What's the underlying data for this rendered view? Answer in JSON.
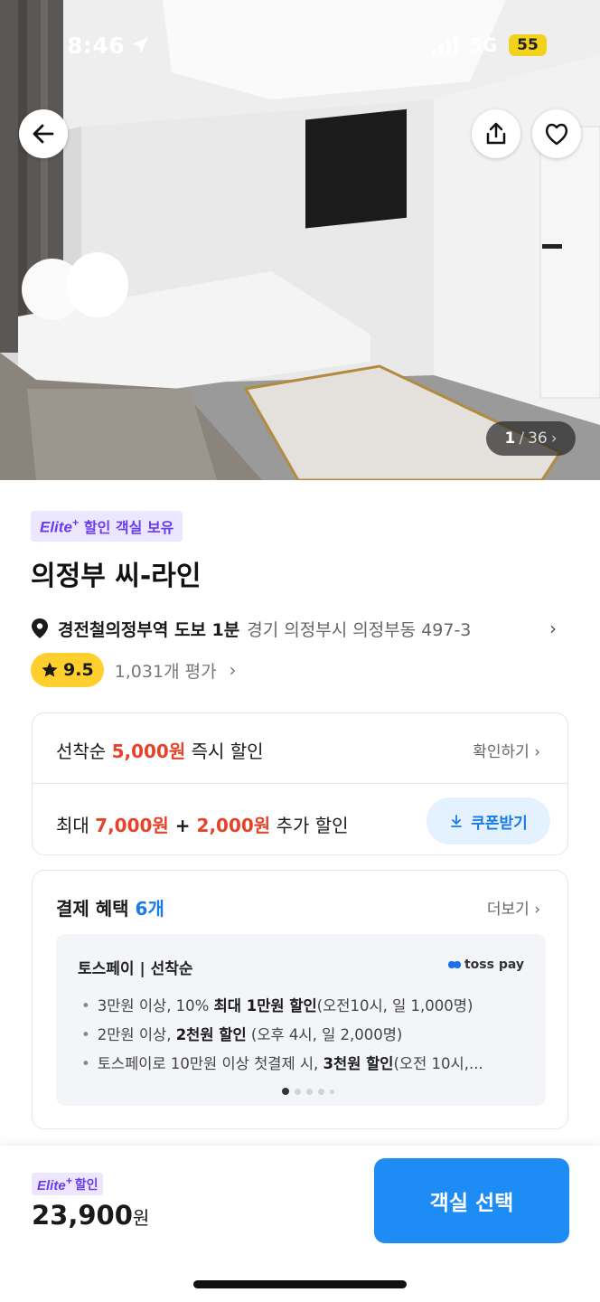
{
  "status_bar": {
    "time": "8:46",
    "network": "5G",
    "battery": "55"
  },
  "gallery": {
    "current": "1",
    "separator": "/",
    "total": "36"
  },
  "icons": {
    "back": "arrow-left-icon",
    "share": "share-icon",
    "favorite": "heart-icon",
    "location": "location-pin-icon",
    "star": "star-icon",
    "download": "download-icon"
  },
  "elite_badge": {
    "logo": "Elite",
    "plus": "+",
    "text": "할인 객실 보유"
  },
  "hotel": {
    "name": "의정부 씨-라인",
    "address_highlight": "경전철의정부역 도보 1분",
    "address": "경기 의정부시 의정부동 497-3",
    "rating": "9.5",
    "review_count": "1,031개 평가"
  },
  "discounts": {
    "row1": {
      "prefix": "선착순 ",
      "amount": "5,000원",
      "suffix": " 즉시 할인",
      "link": "확인하기 ›"
    },
    "row2": {
      "prefix": "최대 ",
      "amount1": "7,000원",
      "plus": " + ",
      "amount2": "2,000원",
      "suffix": " 추가 할인",
      "button": "쿠폰받기"
    }
  },
  "payment": {
    "title": "결제 혜택 ",
    "count": "6개",
    "more": "더보기 ›",
    "card_title": "토스페이 | 선착순",
    "brand": "toss pay",
    "benefits": [
      {
        "pre": "3만원 이상, 10% ",
        "bold": "최대 1만원 할인",
        "post": "(오전10시, 일 1,000명)"
      },
      {
        "pre": "2만원 이상, ",
        "bold": "2천원 할인",
        "post": " (오후 4시, 일 2,000명)"
      },
      {
        "pre": "토스페이로 10만원 이상 첫결제 시, ",
        "bold": "3천원 할인",
        "post": "(오전 10시,..."
      }
    ]
  },
  "bottom": {
    "badge_logo": "Elite",
    "badge_plus": "+",
    "badge_text": "할인",
    "price": "23,900",
    "currency": "원",
    "cta": "객실 선택"
  },
  "colors": {
    "accent_blue": "#1e8cf5",
    "discount_red": "#e5432b",
    "elite_purple": "#6a3cf0",
    "rating_yellow": "#ffcf2e"
  }
}
